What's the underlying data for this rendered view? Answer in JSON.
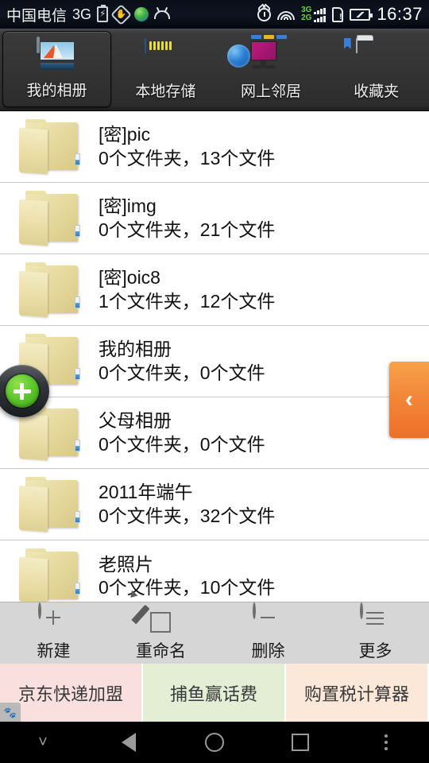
{
  "status_bar": {
    "carrier": "中国电信",
    "network": "3G",
    "time": "16:37",
    "icons_left": [
      "charging-battery-icon",
      "hand-block-icon",
      "green-globe-icon",
      "android-head-icon"
    ],
    "icons_right": [
      "alarm-clock-icon",
      "wifi-icon",
      "dual-sim-signal-icon",
      "sim-alert-icon",
      "battery-icon"
    ],
    "signal_labels": {
      "top": "3G",
      "bottom": "2G"
    }
  },
  "tabs": [
    {
      "label": "我的相册",
      "icon": "photo-album-icon",
      "selected": true
    },
    {
      "label": "本地存储",
      "icon": "sd-card-icon",
      "selected": false
    },
    {
      "label": "网上邻居",
      "icon": "network-neighborhood-icon",
      "selected": false
    },
    {
      "label": "收藏夹",
      "icon": "favorites-folder-icon",
      "selected": false
    }
  ],
  "list": {
    "items": [
      {
        "name": "[密]pic",
        "meta": "0个文件夹，13个文件"
      },
      {
        "name": "[密]img",
        "meta": "0个文件夹，21个文件"
      },
      {
        "name": "[密]oic8",
        "meta": "1个文件夹，12个文件"
      },
      {
        "name": "我的相册",
        "meta": "0个文件夹，0个文件"
      },
      {
        "name": "父母相册",
        "meta": "0个文件夹，0个文件"
      },
      {
        "name": "2011年端午",
        "meta": "0个文件夹，32个文件"
      },
      {
        "name": "老照片",
        "meta": "0个文件夹，10个文件"
      }
    ]
  },
  "floating_buttons": {
    "add_label": "+",
    "drawer_chevron": "‹"
  },
  "toolbar": [
    {
      "label": "新建",
      "icon": "circle-plus-icon"
    },
    {
      "label": "重命名",
      "icon": "pencil-edit-icon"
    },
    {
      "label": "删除",
      "icon": "circle-minus-icon"
    },
    {
      "label": "更多",
      "icon": "circle-menu-icon"
    }
  ],
  "ads": [
    {
      "text": "京东快递加盟",
      "color": "#f9dfdd"
    },
    {
      "text": "捕鱼赢话费",
      "color": "#e3eed5"
    },
    {
      "text": "购置税计算器",
      "color": "#fce8d8"
    }
  ],
  "ad_badge": "paw-icon",
  "nav_bar": [
    "chevron-down-icon",
    "back-icon",
    "home-icon",
    "recents-icon",
    "overflow-menu-icon"
  ],
  "colors": {
    "accent_orange": "#f2873a",
    "accent_green": "#5cc72b",
    "tab_selected_glow": "#2a8ed8",
    "folder_yellow": "#e9dda6"
  }
}
